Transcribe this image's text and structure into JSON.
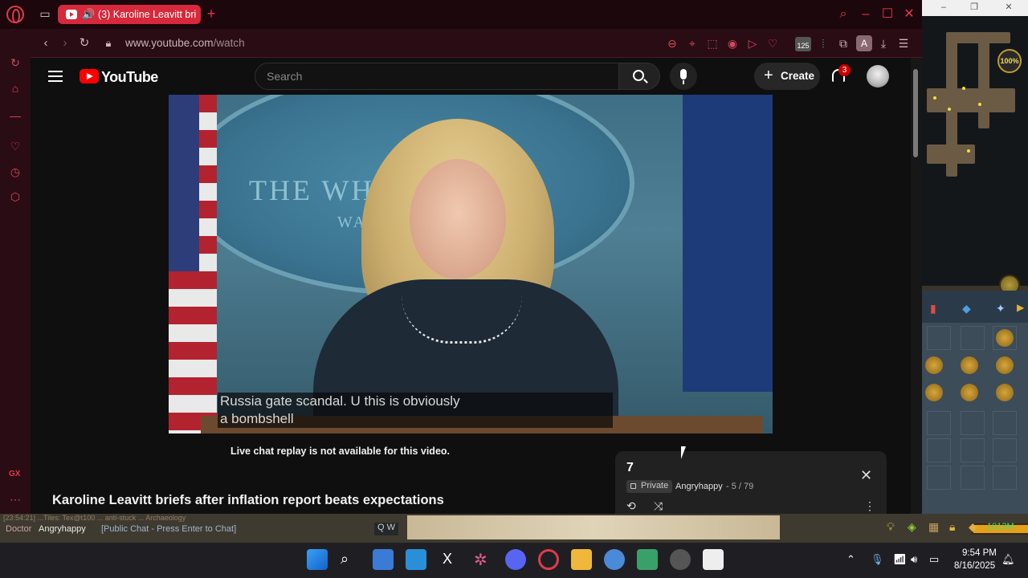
{
  "browser": {
    "tab_title": "(3) Karoline Leavitt bri",
    "url_prefix": "www.youtube.com",
    "url_path": "/watch",
    "extension_badge": "125",
    "profile_letter": "A",
    "sidebar_label": "GX"
  },
  "youtube": {
    "brand": "YouTube",
    "search_placeholder": "Search",
    "create_label": "Create",
    "notification_count": "3",
    "caption_line1": "Russia gate scandal. U this is obviously",
    "caption_line2": "a bombshell",
    "video_backdrop_line1": "THE WHITE HOUSE",
    "video_backdrop_line2": "WASH",
    "live_chat_notice": "Live chat replay is not available for this video.",
    "video_title": "Karoline Leavitt briefs after inflation report beats expectations",
    "playlist": {
      "title": "7",
      "privacy": "Private",
      "owner": "Angryhappy",
      "position": "- 5 / 79"
    }
  },
  "game": {
    "zoom_label": "100%",
    "chat_name_prefix": "Doctor",
    "chat_username": "Angryhappy",
    "chat_prompt": "[Public Chat - Press Enter to Chat]",
    "chat_filter": "Q W",
    "gold_amount": "1013M",
    "chat_scrollback": "[23:54:21] ...Tiles: Tex@t100 ... anti-stuck ... Archaeology"
  },
  "taskbar": {
    "time": "9:54 PM",
    "date": "8/16/2025"
  }
}
